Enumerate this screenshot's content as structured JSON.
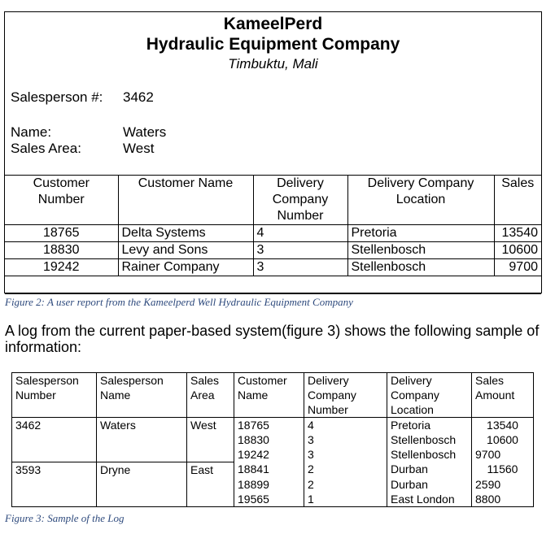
{
  "report": {
    "company_line1": "KameelPerd",
    "company_line2": "Hydraulic Equipment Company",
    "location": "Timbuktu, Mali",
    "salesperson_label": "Salesperson #:",
    "salesperson_value": "3462",
    "name_label": "Name:",
    "name_value": "Waters",
    "area_label": "Sales Area:",
    "area_value": "West",
    "columns": [
      "Customer Number",
      "Customer Name",
      "Delivery Company Number",
      "Delivery Company Location",
      "Sales"
    ],
    "rows": [
      [
        "18765",
        "Delta Systems",
        "4",
        "Pretoria",
        "13540"
      ],
      [
        "18830",
        "Levy and Sons",
        "3",
        "Stellenbosch",
        "10600"
      ],
      [
        "19242",
        "Rainer Company",
        "3",
        "Stellenbosch",
        "9700"
      ]
    ]
  },
  "figure2_caption": "Figure 2: A user report from the Kameelperd Well Hydraulic Equipment Company",
  "intro_text": "A log from the current paper-based system(figure 3) shows the following sample of information:",
  "log": {
    "columns": [
      "Salesperson Number",
      "Salesperson Name",
      "Sales Area",
      "Customer Name",
      "Delivery Company Number",
      "Delivery Company Location",
      "Sales Amount"
    ],
    "rows": [
      [
        "3462",
        "Waters",
        "West",
        "18765",
        "4",
        "Pretoria",
        "13540"
      ],
      [
        "",
        "",
        "",
        "18830",
        "3",
        "Stellenbosch",
        "10600"
      ],
      [
        "",
        "",
        "",
        "19242",
        "3",
        "Stellenbosch",
        "9700"
      ],
      [
        "3593",
        "Dryne",
        "East",
        "18841",
        "2",
        "Durban",
        "11560"
      ],
      [
        "",
        "",
        "",
        "18899",
        "2",
        "Durban",
        "2590"
      ],
      [
        "",
        "",
        "",
        "19565",
        "1",
        "East London",
        "8800"
      ]
    ]
  },
  "figure3_caption": "Figure 3: Sample of the Log"
}
